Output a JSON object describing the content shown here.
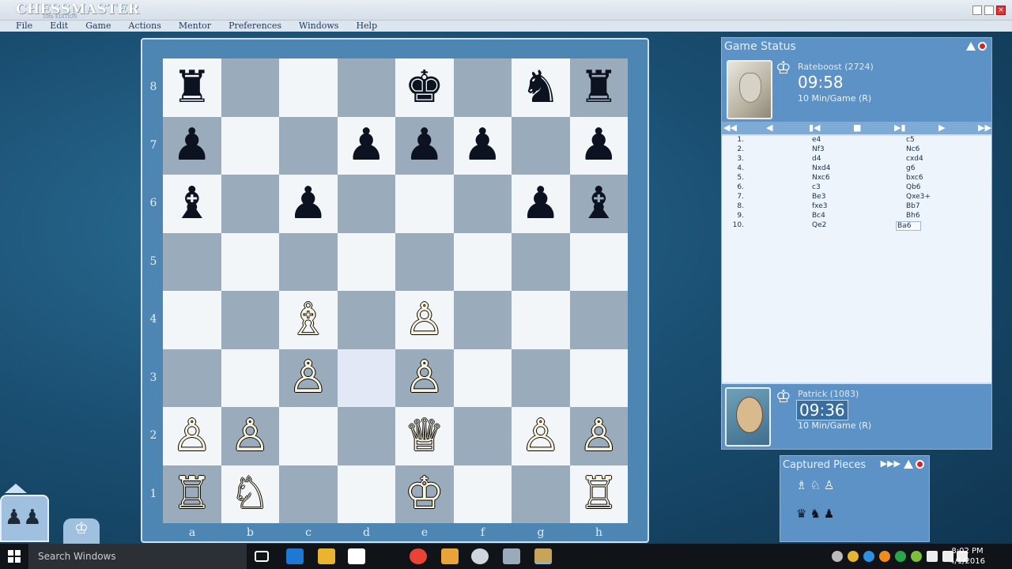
{
  "app": {
    "logo": "CHESSMASTER",
    "logo_sub": "10th EDITION",
    "menu": [
      "File",
      "Edit",
      "Game",
      "Actions",
      "Mentor",
      "Preferences",
      "Windows",
      "Help"
    ]
  },
  "board": {
    "ranks": [
      "8",
      "7",
      "6",
      "5",
      "4",
      "3",
      "2",
      "1"
    ],
    "files": [
      "a",
      "b",
      "c",
      "d",
      "e",
      "f",
      "g",
      "h"
    ],
    "rows": [
      [
        "bR",
        "",
        "",
        "",
        "bK",
        "",
        "bN",
        "bR"
      ],
      [
        "bP",
        "",
        "",
        "bP",
        "bP",
        "bP",
        "",
        "bP"
      ],
      [
        "bB",
        "",
        "bP",
        "",
        "",
        "",
        "bP",
        "bB"
      ],
      [
        "",
        "",
        "",
        "",
        "",
        "",
        "",
        ""
      ],
      [
        "",
        "",
        "wB",
        "",
        "wP",
        "",
        "",
        ""
      ],
      [
        "",
        "",
        "wP",
        "",
        "wP",
        "",
        "",
        ""
      ],
      [
        "wP",
        "wP",
        "",
        "",
        "wQ",
        "",
        "wP",
        "wP"
      ],
      [
        "wR",
        "wN",
        "",
        "",
        "wK",
        "",
        "",
        "wR"
      ]
    ],
    "highlight_square": "d3"
  },
  "game_status": {
    "title": "Game Status",
    "opponent": {
      "name": "Rateboost (2724)",
      "clock": "09:58",
      "time_control": "10 Min/Game (R)"
    },
    "player": {
      "name": "Patrick (1083)",
      "clock": "09:36",
      "time_control": "10 Min/Game (R)"
    },
    "moves": [
      {
        "n": "1.",
        "w": "e4",
        "b": "c5"
      },
      {
        "n": "2.",
        "w": "Nf3",
        "b": "Nc6"
      },
      {
        "n": "3.",
        "w": "d4",
        "b": "cxd4"
      },
      {
        "n": "4.",
        "w": "Nxd4",
        "b": "g6"
      },
      {
        "n": "5.",
        "w": "Nxc6",
        "b": "bxc6"
      },
      {
        "n": "6.",
        "w": "c3",
        "b": "Qb6"
      },
      {
        "n": "7.",
        "w": "Be3",
        "b": "Qxe3+"
      },
      {
        "n": "8.",
        "w": "fxe3",
        "b": "Bb7"
      },
      {
        "n": "9.",
        "w": "Bc4",
        "b": "Bh6"
      },
      {
        "n": "10.",
        "w": "Qe2",
        "b": "Ba6"
      }
    ],
    "selected_move": "Ba6"
  },
  "captured": {
    "title": "Captured Pieces",
    "arrows": "▶▶▶",
    "white": "♗♘♙",
    "black": "♛♞♟"
  },
  "taskbar": {
    "search_placeholder": "Search Windows",
    "time": "8:02 PM",
    "date": "4/1/2016"
  },
  "colors": {
    "panel_header": "#5c92c5",
    "board_light": "#f3f6f9",
    "board_dark": "#9aacbc",
    "frame": "#4d86b3"
  }
}
